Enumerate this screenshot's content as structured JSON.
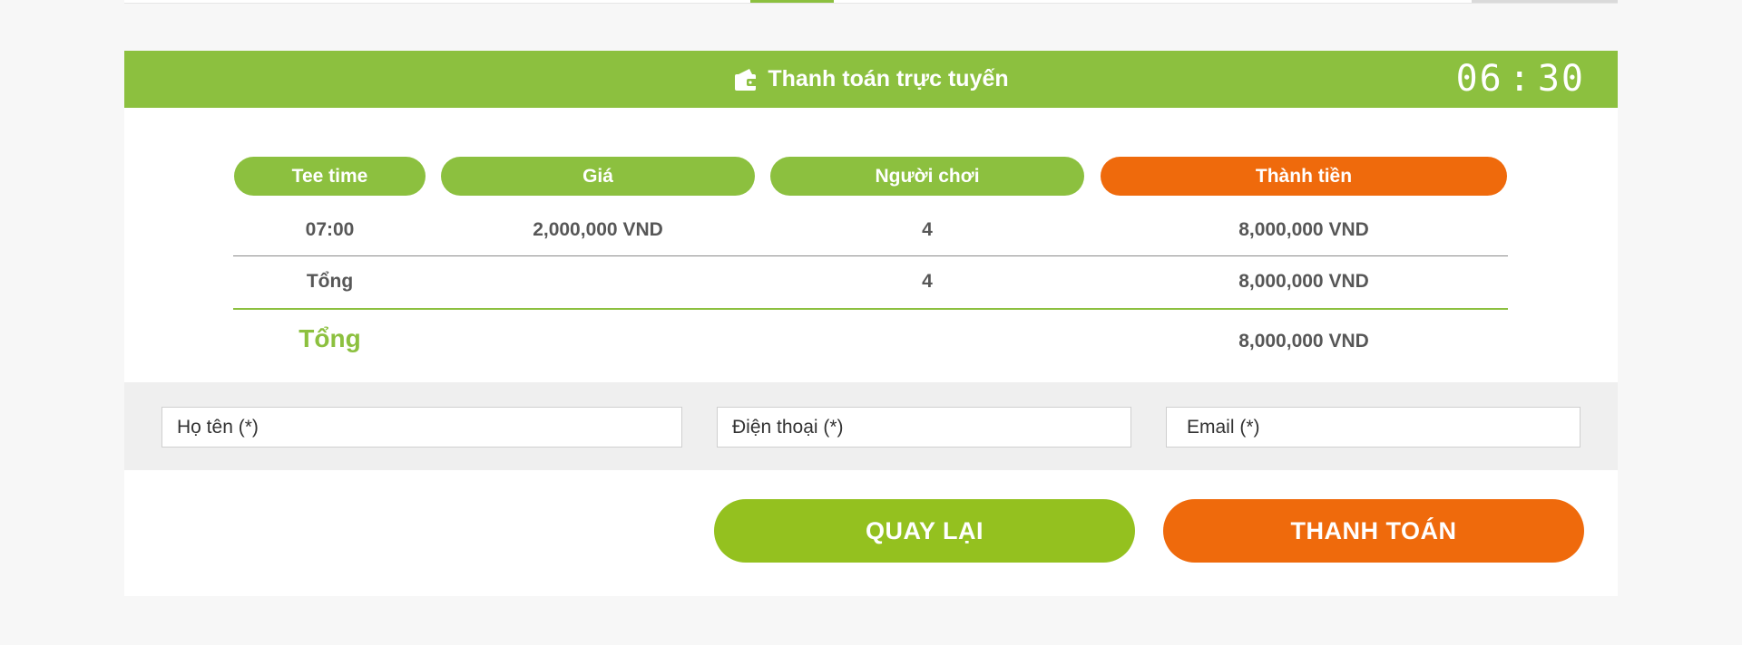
{
  "header": {
    "title": "Thanh toán trực tuyến",
    "icon": "wallet-icon",
    "timer_minutes": "06",
    "timer_separator": ":",
    "timer_seconds": "30"
  },
  "table": {
    "columns": [
      "Tee time",
      "Giá",
      "Người chơi",
      "Thành tiền"
    ],
    "rows": [
      {
        "tee_time": "07:00",
        "price": "2,000,000 VND",
        "players": "4",
        "amount": "8,000,000 VND"
      }
    ],
    "subtotal": {
      "label": "Tổng",
      "players": "4",
      "amount": "8,000,000 VND"
    },
    "total": {
      "label": "Tổng",
      "amount": "8,000,000 VND"
    }
  },
  "form": {
    "name_placeholder": "Họ tên (*)",
    "phone_placeholder": "Điện thoại (*)",
    "email_placeholder": "Email (*)"
  },
  "buttons": {
    "back_label": "QUAY LẠI",
    "pay_label": "THANH TOÁN"
  },
  "colors": {
    "brand_green": "#8cc03f",
    "button_green": "#94c11f",
    "accent_orange": "#ef6a0c",
    "text_gray": "#575757"
  }
}
